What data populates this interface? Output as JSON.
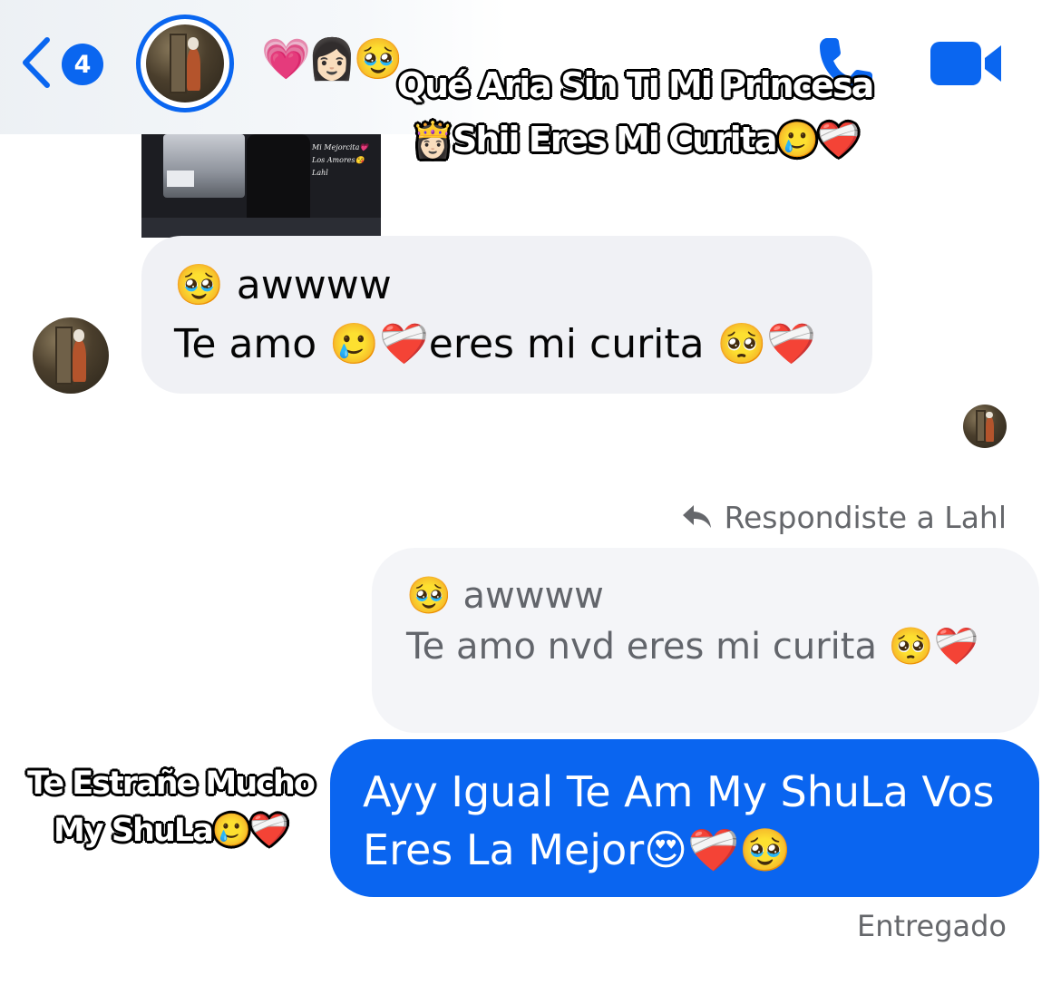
{
  "header": {
    "unread_count": "4",
    "title": "💗👩🏻🥹",
    "icons": [
      "chevron-left-icon",
      "phone-icon",
      "video-camera-icon"
    ],
    "accent_color": "#0a66f0"
  },
  "captions": {
    "top": "Qué Aria Sin Ti Mi Princesa 👸🏻Shii Eres Mi Curita🥲❤️‍🩹",
    "left": "Te Estrañe Mucho My ShuLa🥲❤️‍🩹"
  },
  "photo_preview": {
    "overlay_line1": "Mi Mejorcita💗",
    "overlay_line2": "Los Amores😘",
    "overlay_line3": "Lahl"
  },
  "incoming_message": {
    "line1": "🥹 awwww",
    "line2": "Te amo 🥲❤️‍🩹eres mi curita 🥺❤️‍🩹"
  },
  "reply": {
    "label": "Respondiste a Lahl",
    "quoted_line1": "🥹 awwww",
    "quoted_line2": "Te amo nvd eres mi curita 🥺❤️‍🩹"
  },
  "outgoing_message": {
    "text": "Ayy Igual Te Am My ShuLa Vos Eres La Mejor😍❤️‍🩹🥹"
  },
  "status": "Entregado",
  "colors": {
    "outgoing_bubble": "#0a65f0",
    "incoming_bubble": "#f0f1f5",
    "muted_text": "#65676b"
  }
}
